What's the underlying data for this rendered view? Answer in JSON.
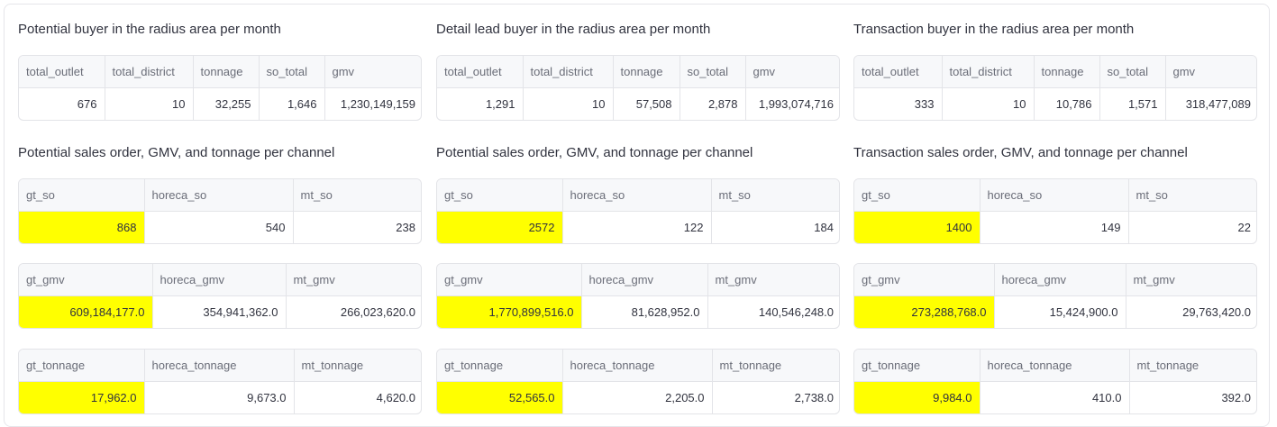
{
  "highlight_color": "#ffff00",
  "columns": [
    {
      "buyer_title": "Potential buyer in the radius area per month",
      "buyer_headers": [
        "total_outlet",
        "total_district",
        "tonnage",
        "so_total",
        "gmv"
      ],
      "buyer_values": [
        "676",
        "10",
        "32,255",
        "1,646",
        "1,230,149,159"
      ],
      "channel_title": "Potential sales order, GMV, and tonnage per channel",
      "so_headers": [
        "gt_so",
        "horeca_so",
        "mt_so"
      ],
      "so_values": [
        "868",
        "540",
        "238"
      ],
      "gmv_headers": [
        "gt_gmv",
        "horeca_gmv",
        "mt_gmv"
      ],
      "gmv_values": [
        "609,184,177.0",
        "354,941,362.0",
        "266,023,620.0"
      ],
      "tonnage_headers": [
        "gt_tonnage",
        "horeca_tonnage",
        "mt_tonnage"
      ],
      "tonnage_values": [
        "17,962.0",
        "9,673.0",
        "4,620.0"
      ]
    },
    {
      "buyer_title": "Detail lead buyer in the radius area per month",
      "buyer_headers": [
        "total_outlet",
        "total_district",
        "tonnage",
        "so_total",
        "gmv"
      ],
      "buyer_values": [
        "1,291",
        "10",
        "57,508",
        "2,878",
        "1,993,074,716"
      ],
      "channel_title": "Potential sales order, GMV, and tonnage per channel",
      "so_headers": [
        "gt_so",
        "horeca_so",
        "mt_so"
      ],
      "so_values": [
        "2572",
        "122",
        "184"
      ],
      "gmv_headers": [
        "gt_gmv",
        "horeca_gmv",
        "mt_gmv"
      ],
      "gmv_values": [
        "1,770,899,516.0",
        "81,628,952.0",
        "140,546,248.0"
      ],
      "tonnage_headers": [
        "gt_tonnage",
        "horeca_tonnage",
        "mt_tonnage"
      ],
      "tonnage_values": [
        "52,565.0",
        "2,205.0",
        "2,738.0"
      ]
    },
    {
      "buyer_title": "Transaction buyer in the radius area per month",
      "buyer_headers": [
        "total_outlet",
        "total_district",
        "tonnage",
        "so_total",
        "gmv"
      ],
      "buyer_values": [
        "333",
        "10",
        "10,786",
        "1,571",
        "318,477,089"
      ],
      "channel_title": "Transaction sales order, GMV, and tonnage per channel",
      "so_headers": [
        "gt_so",
        "horeca_so",
        "mt_so"
      ],
      "so_values": [
        "1400",
        "149",
        "22"
      ],
      "gmv_headers": [
        "gt_gmv",
        "horeca_gmv",
        "mt_gmv"
      ],
      "gmv_values": [
        "273,288,768.0",
        "15,424,900.0",
        "29,763,420.0"
      ],
      "tonnage_headers": [
        "gt_tonnage",
        "horeca_tonnage",
        "mt_tonnage"
      ],
      "tonnage_values": [
        "9,984.0",
        "410.0",
        "392.0"
      ]
    }
  ]
}
